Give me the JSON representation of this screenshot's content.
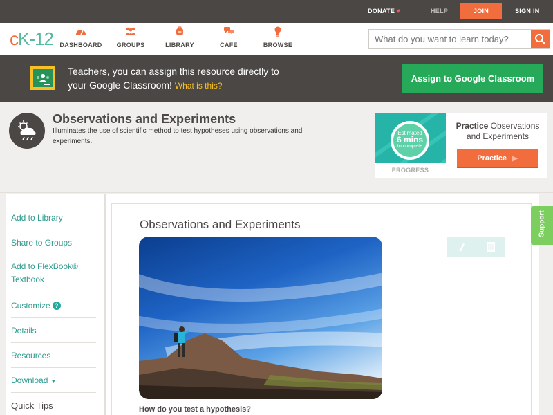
{
  "topbar": {
    "donate": "DONATE",
    "help": "HELP",
    "join": "JOIN",
    "signin": "SIGN IN"
  },
  "logo": {
    "c": "c",
    "k": "K",
    "dash": "-",
    "num": "12"
  },
  "nav": {
    "items": [
      {
        "label": "DASHBOARD",
        "icon": "speedometer-icon"
      },
      {
        "label": "GROUPS",
        "icon": "people-icon"
      },
      {
        "label": "LIBRARY",
        "icon": "backpack-icon"
      },
      {
        "label": "CAFE",
        "icon": "chat-bubbles-icon"
      },
      {
        "label": "BROWSE",
        "icon": "lightbulb-icon"
      }
    ],
    "search_placeholder": "What do you want to learn today?"
  },
  "classroom": {
    "line1": "Teachers, you can assign this resource directly to",
    "line2": "your Google Classroom!",
    "whatis": "What is this?",
    "button": "Assign to Google Classroom"
  },
  "lesson": {
    "title": "Observations and Experiments",
    "description": "Illuminates the use of scientific method to test hypotheses using observations and experiments."
  },
  "practice": {
    "estimated": "Estimated",
    "mins": "6 mins",
    "to_complete": "to complete",
    "progress": "PROGRESS",
    "title_bold": "Practice",
    "title_rest": "Observations and Experiments",
    "button": "Practice"
  },
  "sidebar": {
    "items": [
      {
        "label": "Add to Library"
      },
      {
        "label": "Share to Groups"
      },
      {
        "label": "Add to FlexBook® Textbook"
      },
      {
        "label": "Customize"
      },
      {
        "label": "Details"
      },
      {
        "label": "Resources"
      },
      {
        "label": "Download"
      },
      {
        "label": "Quick Tips"
      }
    ],
    "help_glyph": "?"
  },
  "content": {
    "title": "Observations and Experiments",
    "question": "How do you test a hypothesis?"
  },
  "support": "Support",
  "colors": {
    "brand_orange": "#f26d3d",
    "brand_teal": "#56b99b",
    "dark_bar": "#4a4744",
    "classroom_green": "#27a95a",
    "support_green": "#7ccf5e"
  }
}
